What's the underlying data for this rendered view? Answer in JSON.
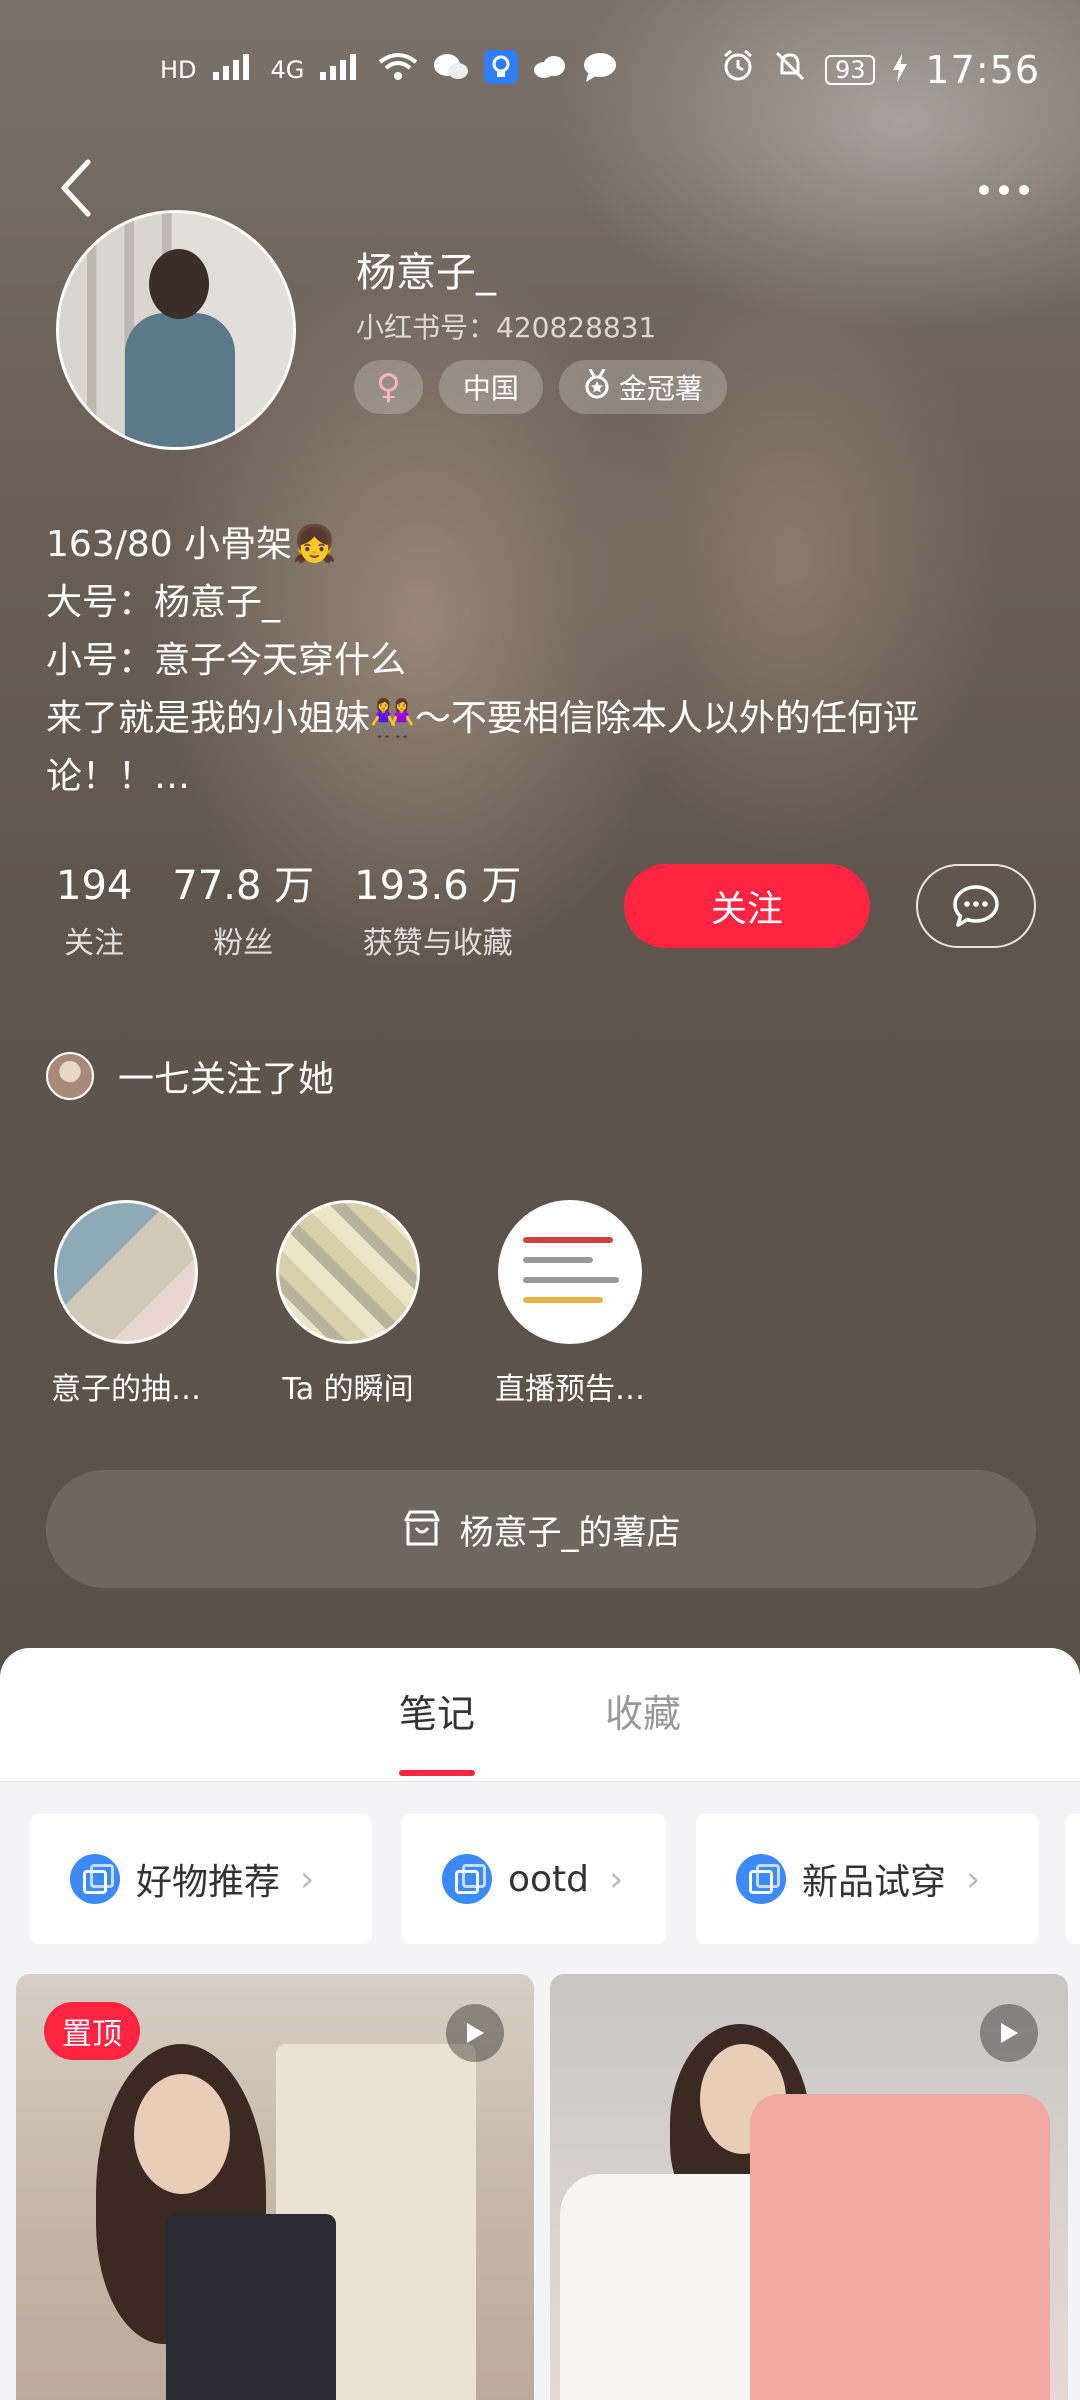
{
  "status_bar": {
    "time": "17:56",
    "battery": "93",
    "signal_labels": [
      "HD",
      "4G",
      "4G"
    ]
  },
  "profile": {
    "nickname": "杨意子_",
    "red_id": "小红书号：420828831",
    "tags": [
      {
        "icon": "female-icon",
        "label": ""
      },
      {
        "icon": "",
        "label": "中国"
      },
      {
        "icon": "medal-icon",
        "label": "金冠薯"
      }
    ],
    "bio_lines": [
      "163/80 小骨架👧",
      "大号：杨意子_",
      "小号：意子今天穿什么",
      "来了就是我的小姐妹👭～不要相信除本人以外的任何评",
      "论！！…"
    ],
    "stats": [
      {
        "value": "194",
        "label": "关注"
      },
      {
        "value": "77.8 万",
        "label": "粉丝"
      },
      {
        "value": "193.6 万",
        "label": "获赞与收藏"
      }
    ],
    "follow_button": "关注",
    "mutual_follow_text": "一七关注了她"
  },
  "highlights": [
    {
      "label": "意子的抽…"
    },
    {
      "label": "Ta 的瞬间"
    },
    {
      "label": "直播预告…"
    }
  ],
  "shop": {
    "label": "杨意子_的薯店"
  },
  "tabs": [
    {
      "label": "笔记",
      "active": true
    },
    {
      "label": "收藏",
      "active": false
    }
  ],
  "collections": [
    {
      "label": "好物推荐"
    },
    {
      "label": "ootd"
    },
    {
      "label": "新品试穿"
    }
  ],
  "notes": [
    {
      "badge": "置顶",
      "type": "video"
    },
    {
      "badge": "",
      "type": "video"
    }
  ],
  "colors": {
    "accent": "#ff2442",
    "collection_icon": "#3d8af7",
    "panel_bg": "#f4f4f6"
  }
}
